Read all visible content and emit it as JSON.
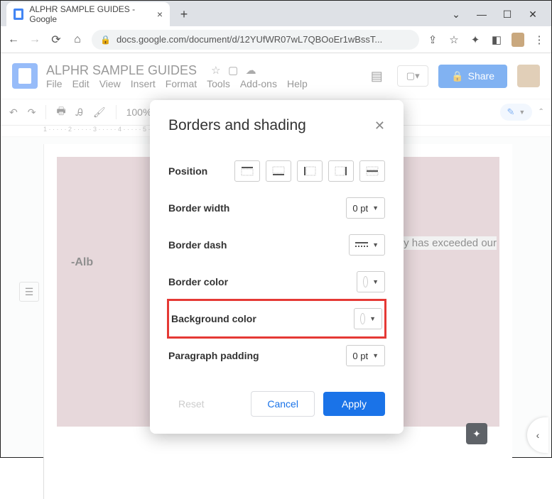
{
  "browser": {
    "tab_title": "ALPHR SAMPLE GUIDES - Google",
    "url_display": "docs.google.com/document/d/12YUfWR07wL7QBOoEr1wBssT..."
  },
  "docs": {
    "title": "ALPHR SAMPLE GUIDES",
    "menu": {
      "file": "File",
      "edit": "Edit",
      "view": "View",
      "insert": "Insert",
      "format": "Format",
      "tools": "Tools",
      "addons": "Add-ons",
      "help": "Help"
    },
    "share_label": "Share",
    "zoom": "100%"
  },
  "page": {
    "quote_fragment": "nology has exceeded our",
    "author": "-Alb"
  },
  "dialog": {
    "title": "Borders and shading",
    "position_label": "Position",
    "border_width_label": "Border width",
    "border_width_value": "0 pt",
    "border_dash_label": "Border dash",
    "border_color_label": "Border color",
    "background_color_label": "Background color",
    "paragraph_padding_label": "Paragraph padding",
    "paragraph_padding_value": "0 pt",
    "reset": "Reset",
    "cancel": "Cancel",
    "apply": "Apply"
  }
}
